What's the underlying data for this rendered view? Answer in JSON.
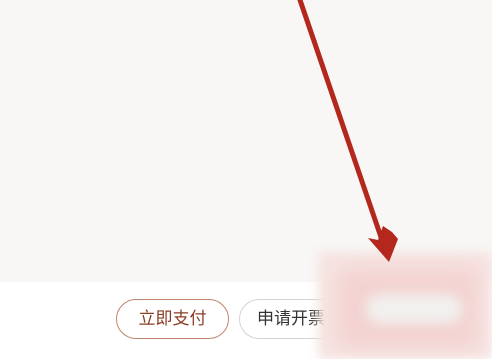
{
  "actions": {
    "pay_now_label": "立即支付",
    "apply_invoice_label": "申请开票"
  },
  "colors": {
    "pay_border": "#c0846c",
    "pay_text": "#8a3c22",
    "arrow": "#b3271c",
    "content_background": "#f8f7f5"
  },
  "annotation": {
    "icon": "red-arrow-icon"
  }
}
